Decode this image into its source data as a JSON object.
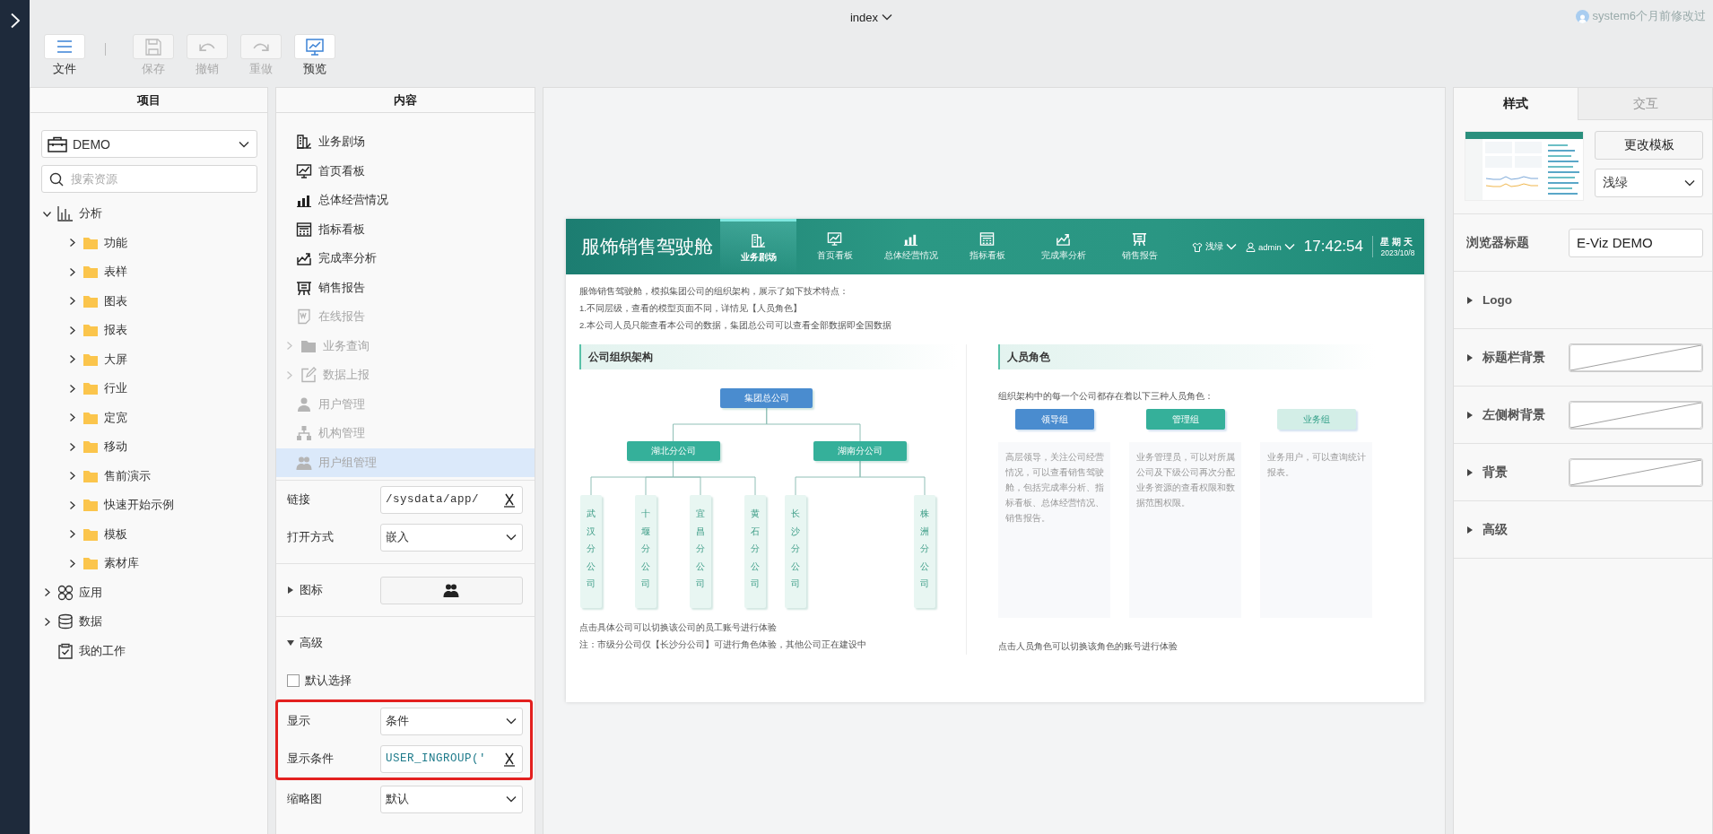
{
  "window": {
    "title": "index",
    "status": "system6个月前修改过"
  },
  "toolbar": [
    {
      "kind": "menu",
      "label": "文件",
      "disabled": false
    },
    {
      "kind": "separator"
    },
    {
      "kind": "save",
      "label": "保存",
      "disabled": true
    },
    {
      "kind": "undo",
      "label": "撤销",
      "disabled": true
    },
    {
      "kind": "redo",
      "label": "重做",
      "disabled": true
    },
    {
      "kind": "preview",
      "label": "预览",
      "disabled": false
    }
  ],
  "project_panel": {
    "title": "项目",
    "project": "DEMO",
    "search": {
      "placeholder": "搜索资源"
    },
    "tree": [
      {
        "label": "分析",
        "kind": "analysis",
        "expanded": true,
        "children": [
          {
            "label": "功能",
            "kind": "folder",
            "expanded": false
          },
          {
            "label": "表样",
            "kind": "folder",
            "expanded": false
          },
          {
            "label": "图表",
            "kind": "folder",
            "expanded": false
          },
          {
            "label": "报表",
            "kind": "folder",
            "expanded": false
          },
          {
            "label": "大屏",
            "kind": "folder",
            "expanded": false
          },
          {
            "label": "行业",
            "kind": "folder",
            "expanded": false
          },
          {
            "label": "定宽",
            "kind": "folder",
            "expanded": false
          },
          {
            "label": "移动",
            "kind": "folder",
            "expanded": false
          },
          {
            "label": "售前演示",
            "kind": "folder",
            "expanded": false
          },
          {
            "label": "快速开始示例",
            "kind": "folder",
            "expanded": false
          },
          {
            "label": "模板",
            "kind": "folder",
            "expanded": false
          },
          {
            "label": "素材库",
            "kind": "folder",
            "expanded": false
          }
        ]
      },
      {
        "label": "应用",
        "kind": "apps",
        "expanded": false
      },
      {
        "label": "数据",
        "kind": "data",
        "expanded": false
      },
      {
        "label": "我的工作",
        "kind": "work"
      }
    ]
  },
  "content_panel": {
    "title": "内容",
    "items": [
      {
        "label": "业务剧场",
        "kind": "theater",
        "disabled": false,
        "selected": false
      },
      {
        "label": "首页看板",
        "kind": "dashboard",
        "disabled": false,
        "selected": false
      },
      {
        "label": "总体经营情况",
        "kind": "bars",
        "disabled": false,
        "selected": false
      },
      {
        "label": "指标看板",
        "kind": "kpi",
        "disabled": false,
        "selected": false
      },
      {
        "label": "完成率分析",
        "kind": "trend",
        "disabled": false,
        "selected": false
      },
      {
        "label": "销售报告",
        "kind": "report",
        "disabled": false,
        "selected": false
      },
      {
        "label": "在线报告",
        "kind": "doc",
        "disabled": true,
        "selected": false
      },
      {
        "label": "业务查询",
        "kind": "folder",
        "disabled": true,
        "selected": false,
        "expanded": false
      },
      {
        "label": "数据上报",
        "kind": "edit",
        "disabled": true,
        "selected": false,
        "expanded": false
      },
      {
        "label": "用户管理",
        "kind": "user",
        "disabled": true,
        "selected": false
      },
      {
        "label": "机构管理",
        "kind": "org",
        "disabled": true,
        "selected": false
      },
      {
        "label": "用户组管理",
        "kind": "users",
        "disabled": true,
        "selected": true
      }
    ],
    "properties": [
      {
        "kind": "formula",
        "label": "链接",
        "value": "/sysdata/app/",
        "highlighted": false
      },
      {
        "kind": "select",
        "label": "打开方式",
        "value": "嵌入",
        "highlighted": false
      },
      {
        "kind": "icon_picker",
        "label": "图标",
        "expanded": false
      },
      {
        "kind": "expander",
        "label": "高级",
        "expanded": true
      },
      {
        "kind": "checkbox",
        "label": "默认选择",
        "checked": false
      },
      {
        "kind": "select",
        "label": "显示",
        "value": "条件",
        "highlighted": true
      },
      {
        "kind": "formula",
        "label": "显示条件",
        "value": "USER_INGROUP('",
        "highlighted": true
      },
      {
        "kind": "select",
        "label": "缩略图",
        "value": "默认",
        "highlighted": false
      }
    ]
  },
  "preview": {
    "header": {
      "title": "服饰销售驾驶舱",
      "nav": [
        {
          "label": "业务剧场",
          "kind": "theater",
          "selected": true
        },
        {
          "label": "首页看板",
          "kind": "dashboard",
          "selected": false
        },
        {
          "label": "总体经营情况",
          "kind": "bars",
          "selected": false
        },
        {
          "label": "指标看板",
          "kind": "kpi",
          "selected": false
        },
        {
          "label": "完成率分析",
          "kind": "trend",
          "selected": false
        },
        {
          "label": "销售报告",
          "kind": "report",
          "selected": false
        }
      ],
      "theme": "浅绿",
      "user": "admin",
      "time": "17:42:54",
      "weekday": "星期天",
      "date": "2023/10/8"
    },
    "intro": [
      "服饰销售驾驶舱，模拟集团公司的组织架构，展示了如下技术特点：",
      "1.不同层级，查看的模型页面不同，详情见【人员角色】",
      "2.本公司人员只能查看本公司的数据，集团总公司可以查看全部数据即全国数据"
    ],
    "org": {
      "title": "公司组织架构",
      "root": {
        "label": "集团总公司",
        "children": [
          {
            "label": "湖北分公司",
            "children": [
              {
                "label": "武汉分公司"
              },
              {
                "label": "十堰分公司"
              },
              {
                "label": "宜昌分公司"
              },
              {
                "label": "黄石分公司"
              }
            ]
          },
          {
            "label": "湖南分公司",
            "children": [
              {
                "label": "长沙分公司"
              },
              {
                "label": "株洲分公司"
              }
            ]
          }
        ]
      },
      "notes": [
        "点击具体公司可以切换该公司的员工账号进行体验",
        "注：市级分公司仅【长沙分公司】可进行角色体验，其他公司正在建设中"
      ]
    },
    "roles": {
      "title": "人员角色",
      "intro": "组织架构中的每一个公司都存在着以下三种人员角色：",
      "groups": [
        {
          "label": "领导组",
          "color": "#4a8ccf",
          "description": "高层领导，关注公司经营情况，可以查看销售驾驶舱，包括完成率分析、指标看板、总体经营情况、销售报告。"
        },
        {
          "label": "管理组",
          "color": "#35b09a",
          "description": "业务管理员，可以对所属公司及下级公司再次分配业务资源的查看权限和数据范围权限。"
        },
        {
          "label": "业务组",
          "color": "#d3eee7",
          "description": "业务用户，可以查询统计报表。"
        }
      ],
      "note": "点击人员角色可以切换该角色的账号进行体验"
    }
  },
  "right_panel": {
    "tabs": [
      {
        "label": "样式",
        "selected": true
      },
      {
        "label": "交互",
        "selected": false
      }
    ],
    "template": {
      "button": "更改模板",
      "theme": "浅绿"
    },
    "browser_title": {
      "label": "浏览器标题",
      "value": "E-Viz DEMO"
    },
    "sections": [
      {
        "label": "Logo",
        "kind": "plain",
        "expanded": false
      },
      {
        "label": "标题栏背景",
        "kind": "color",
        "expanded": false
      },
      {
        "label": "左侧树背景",
        "kind": "color",
        "expanded": false
      },
      {
        "label": "背景",
        "kind": "color",
        "expanded": false
      },
      {
        "label": "高级",
        "kind": "plain",
        "expanded": false
      }
    ]
  }
}
